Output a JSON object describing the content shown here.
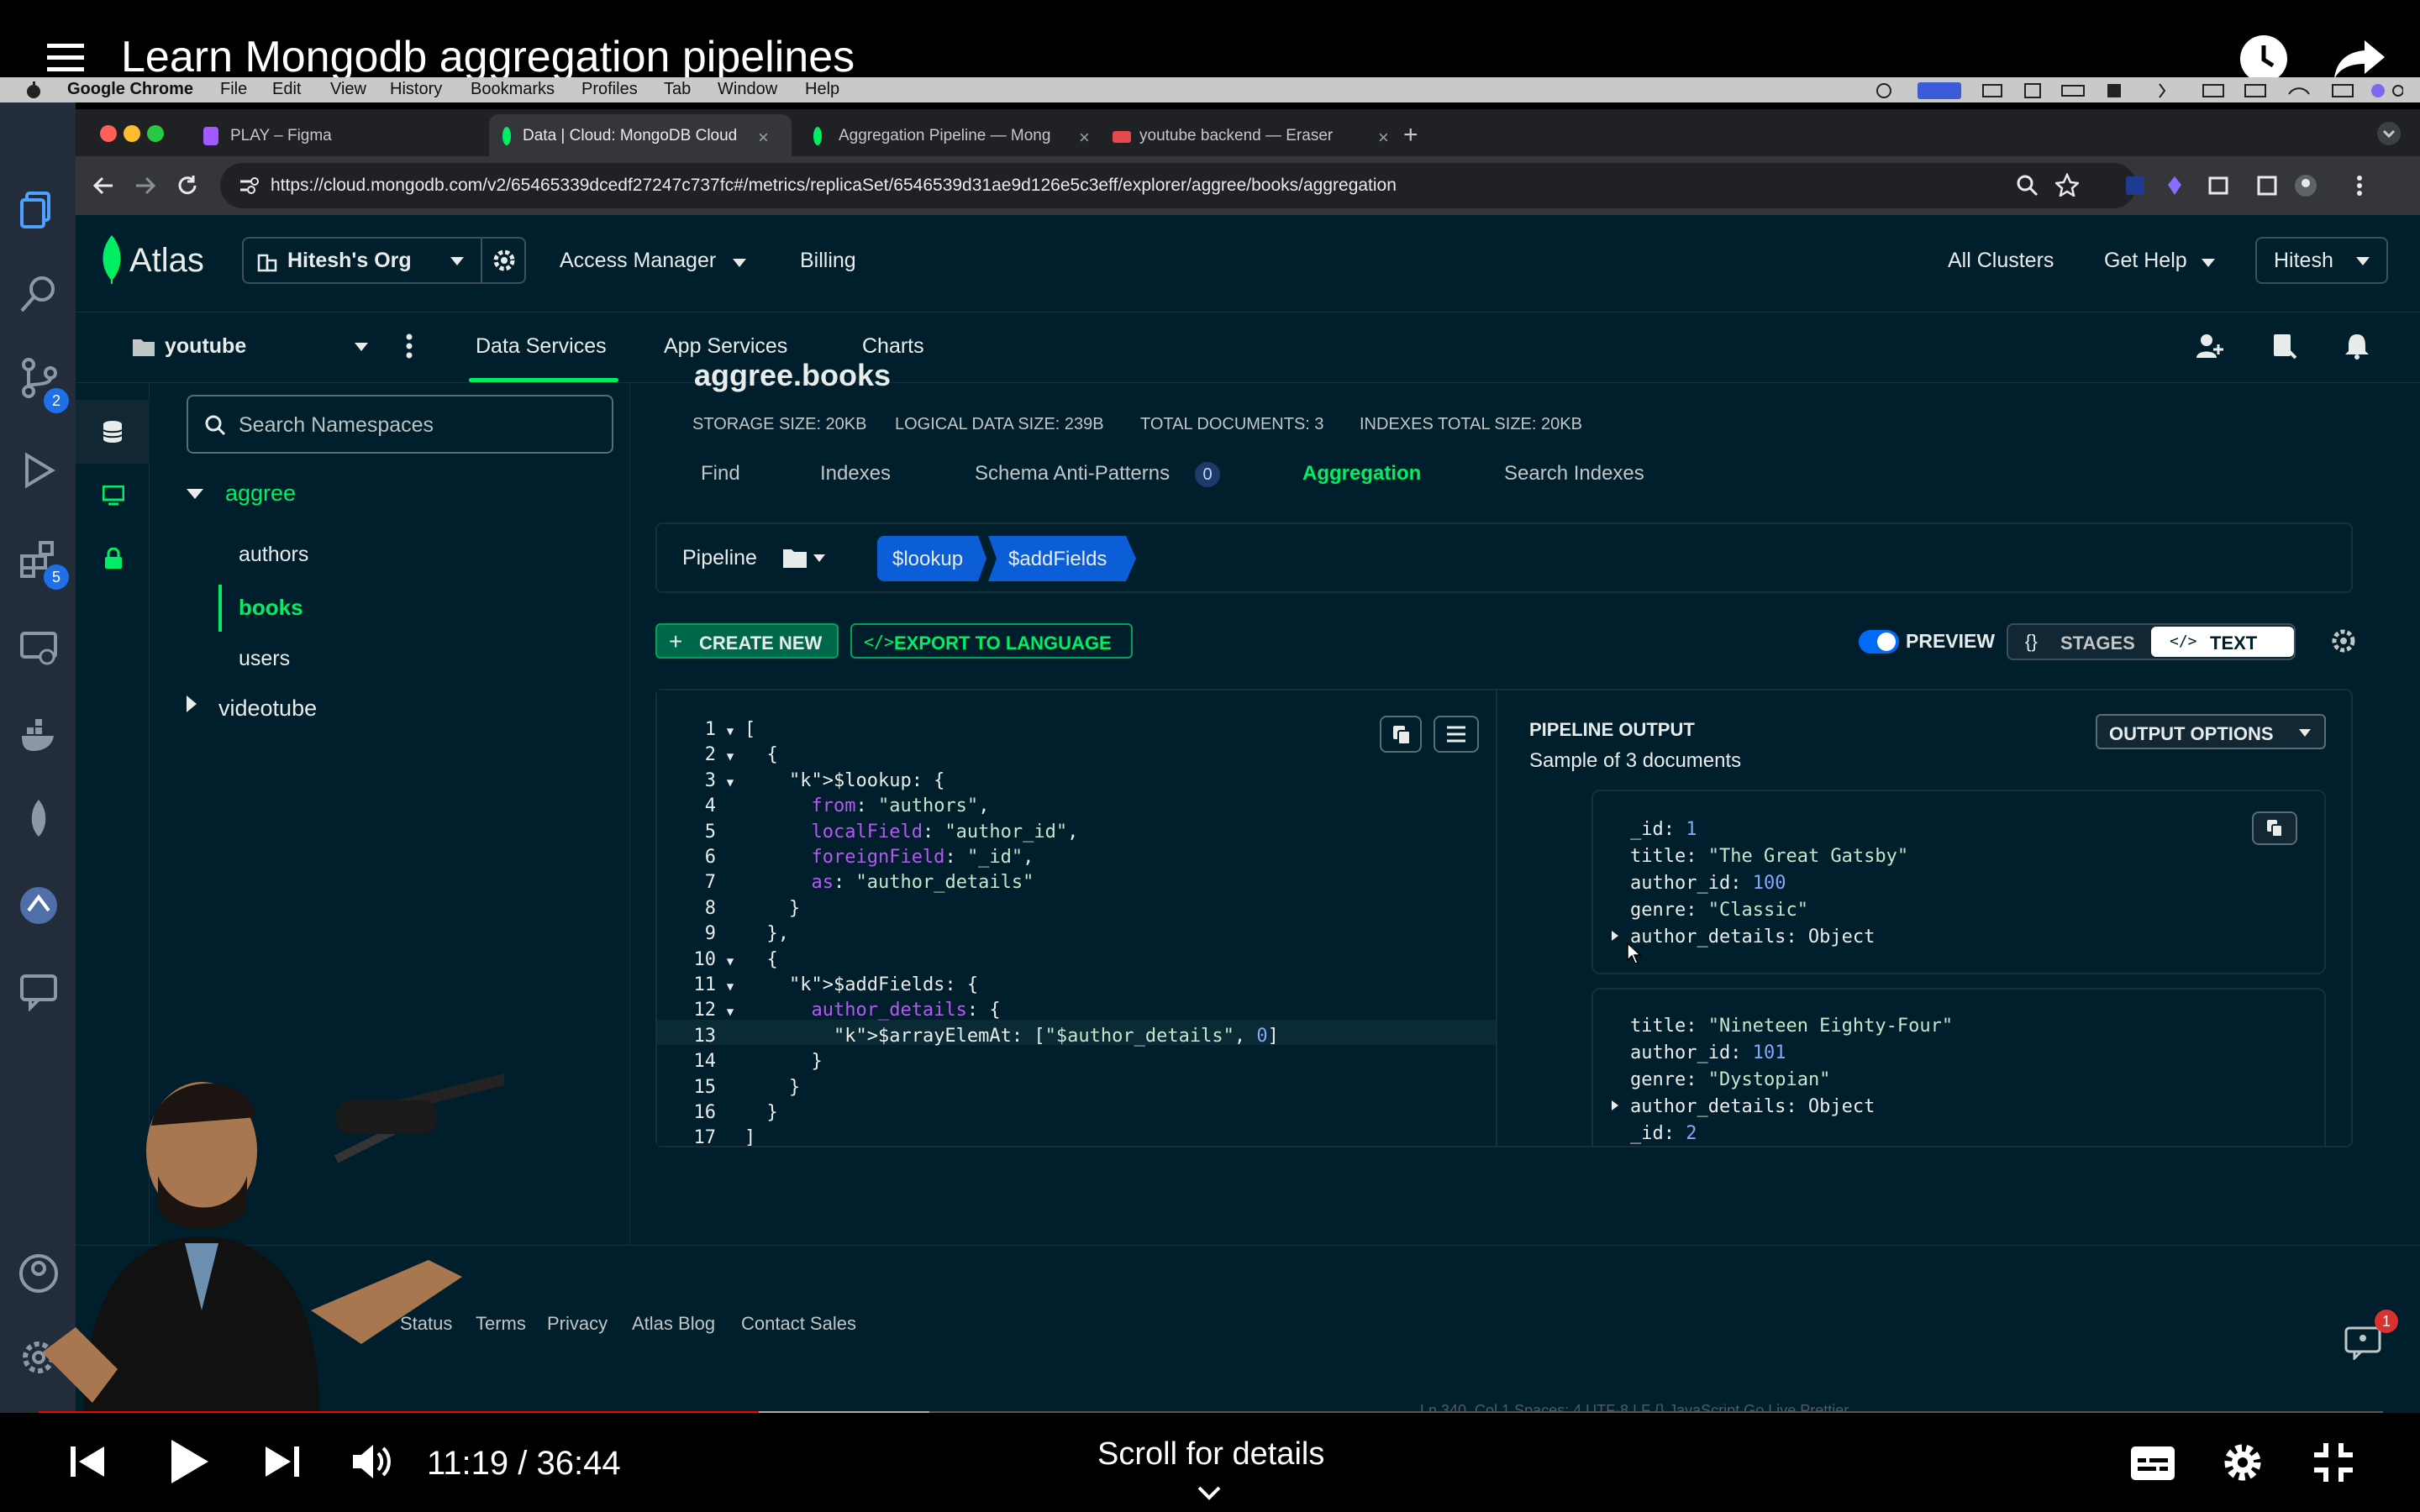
{
  "video": {
    "title": "Learn Mongodb aggregation pipelines",
    "time": "11:19 / 36:44",
    "scroll_hint": "Scroll for details",
    "progress_played": 0.307,
    "progress_buffered": 0.38,
    "accent": "#ff0000"
  },
  "mac_menu": [
    "Google Chrome",
    "File",
    "Edit",
    "View",
    "History",
    "Bookmarks",
    "Profiles",
    "Tab",
    "Window",
    "Help"
  ],
  "activity_bar": {
    "badges": [
      "2",
      "5"
    ]
  },
  "browser": {
    "tabs": [
      {
        "label": "PLAY – Figma"
      },
      {
        "label": "Data | Cloud: MongoDB Cloud"
      },
      {
        "label": "Aggregation Pipeline — Mong"
      },
      {
        "label": "youtube backend — Eraser"
      }
    ],
    "url": "https://cloud.mongodb.com/v2/65465339dcedf27247c737fc#/metrics/replicaSet/6546539d31ae9d126e5c3eff/explorer/aggree/books/aggregation"
  },
  "atlas": {
    "brand": "Atlas",
    "org": "Hitesh's Org",
    "nav": [
      "Access Manager",
      "Billing"
    ],
    "right_nav": [
      "All Clusters",
      "Get Help",
      "Hitesh"
    ],
    "project": "youtube",
    "subnav": [
      "Data Services",
      "App Services",
      "Charts"
    ],
    "accent": "#00ed64"
  },
  "sidebar": {
    "search_placeholder": "Search Namespaces",
    "db": "aggree",
    "collections": [
      "authors",
      "books",
      "users"
    ],
    "other_db": "videotube"
  },
  "collection": {
    "partial_title": "aggree.books",
    "stats": [
      "STORAGE SIZE: 20KB",
      "LOGICAL DATA SIZE: 239B",
      "TOTAL DOCUMENTS: 3",
      "INDEXES TOTAL SIZE: 20KB"
    ],
    "tabs": [
      "Find",
      "Indexes",
      "Schema Anti-Patterns",
      "Aggregation",
      "Search Indexes"
    ],
    "schema_count": "0"
  },
  "pipeline": {
    "label": "Pipeline",
    "stages": [
      "$lookup",
      "$addFields"
    ],
    "create_new": "CREATE NEW",
    "export": "EXPORT TO LANGUAGE",
    "preview": "PREVIEW",
    "stages_btn": "STAGES",
    "text_btn": "TEXT"
  },
  "editor": {
    "lines": [
      "[",
      "  {",
      "    $lookup: {",
      "      from: \"authors\",",
      "      localField: \"author_id\",",
      "      foreignField: \"_id\",",
      "      as: \"author_details\"",
      "    }",
      "  },",
      "  {",
      "    $addFields: {",
      "      author_details: {",
      "        $arrayElemAt: [\"$author_details\", 0]",
      "      }",
      "    }",
      "  }",
      "]"
    ]
  },
  "output": {
    "title": "PIPELINE OUTPUT",
    "sample": "Sample of 3 documents",
    "options": "OUTPUT OPTIONS",
    "doc1": {
      "id_key": "_id:",
      "id_val": "1",
      "title_key": "title:",
      "title_val": "\"The Great Gatsby\"",
      "aid_key": "author_id:",
      "aid_val": "100",
      "genre_key": "genre:",
      "genre_val": "\"Classic\"",
      "details": "author_details: Object"
    },
    "doc2": {
      "title_key": "title:",
      "title_val": "\"Nineteen Eighty-Four\"",
      "aid_key": "author_id:",
      "aid_val": "101",
      "genre_key": "genre:",
      "genre_val": "\"Dystopian\"",
      "details": "author_details: Object",
      "id_key": "_id:",
      "id_val": "2"
    }
  },
  "footer": {
    "links": [
      "Status",
      "Terms",
      "Privacy",
      "Atlas Blog",
      "Contact Sales"
    ],
    "chat_badge": "1",
    "statusbar": "Ln 340, Col 1   Spaces: 4   UTF-8   LF   {} JavaScript   Go Live   Prettier"
  }
}
